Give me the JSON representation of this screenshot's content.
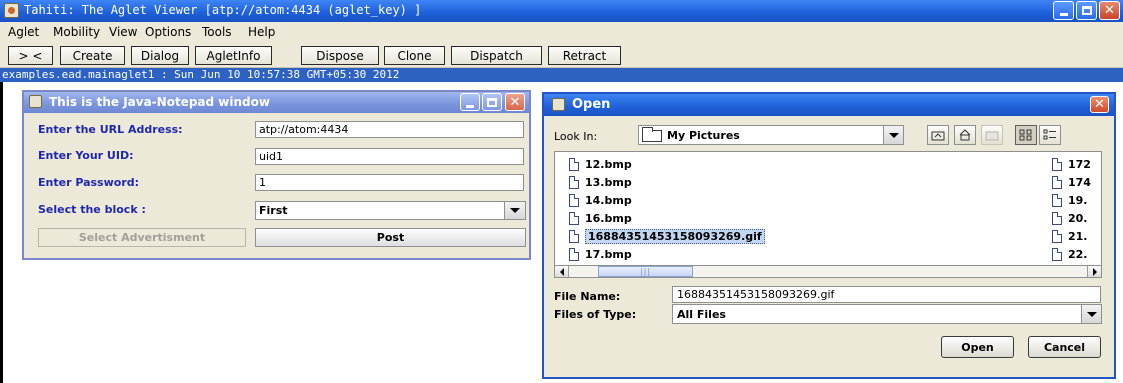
{
  "main_window": {
    "title": "Tahiti: The Aglet Viewer [atp://atom:4434 (aglet_key) ]",
    "menu": [
      "Aglet",
      "Mobility",
      "View",
      "Options",
      "Tools",
      "Help"
    ],
    "toolbar": [
      ">  <",
      "Create",
      "Dialog",
      "AgletInfo",
      "Dispose",
      "Clone",
      "Dispatch",
      "Retract"
    ],
    "status": "examples.ead.mainaglet1 : Sun Jun 10 10:57:38 GMT+05:30 2012",
    "title_buttons": {
      "minimize": "_",
      "maximize": "□",
      "close": "✕"
    }
  },
  "notepad": {
    "title": "This is the Java-Notepad window",
    "url_label": "Enter the URL Address:",
    "url_value": "atp://atom:4434",
    "uid_label": "Enter Your UID:",
    "uid_value": "uid1",
    "password_label": "Enter Password:",
    "password_value": "1",
    "block_label": "Select the block :",
    "block_value": "First",
    "select_ad_button": "Select Advertisment",
    "post_button": "Post"
  },
  "open_dialog": {
    "title": "Open",
    "look_in_label": "Look In:",
    "look_in_value": "My Pictures",
    "files_col1": [
      "12.bmp",
      "13.bmp",
      "14.bmp",
      "16.bmp",
      "16884351453158093269.gif",
      "17.bmp"
    ],
    "files_col2": [
      "172",
      "174",
      "19.",
      "20.",
      "21.",
      "22."
    ],
    "selected_file": "16884351453158093269.gif",
    "file_name_label": "File Name:",
    "file_name_value": "16884351453158093269.gif",
    "file_type_label": "Files of Type:",
    "file_type_value": "All Files",
    "open_button": "Open",
    "cancel_button": "Cancel",
    "scroll_thumb_glyph": "|||"
  },
  "colors": {
    "title_blue": "#1e5fd8",
    "status_blue": "#2d62c2",
    "label_blue": "#1f27b0",
    "selection": "#c4d6f1",
    "window_bg": "#ece9d8"
  }
}
